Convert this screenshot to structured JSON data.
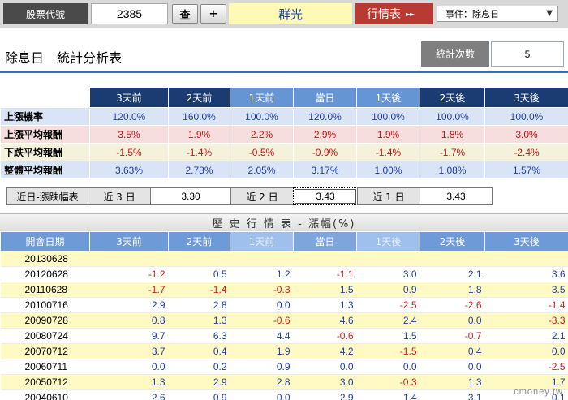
{
  "topbar": {
    "code_label": "股票代號",
    "code_value": "2385",
    "search_button": "查",
    "add_button": "+",
    "stock_name": "群光",
    "quote_link": "行情表",
    "quote_arrow": "►►",
    "event_select": "事件：除息日"
  },
  "title": {
    "main": "除息日　統計分析表",
    "stat_count_label": "統計次數",
    "stat_count_value": "5"
  },
  "stats": {
    "headers": [
      "3天前",
      "2天前",
      "1天前",
      "當日",
      "1天後",
      "2天後",
      "3天後"
    ],
    "rows": [
      {
        "label": "上漲機率",
        "values": [
          "120.0%",
          "160.0%",
          "100.0%",
          "120.0%",
          "100.0%",
          "100.0%",
          "100.0%"
        ]
      },
      {
        "label": "上漲平均報酬",
        "values": [
          "3.5%",
          "1.9%",
          "2.2%",
          "2.9%",
          "1.9%",
          "1.8%",
          "3.0%"
        ]
      },
      {
        "label": "下跌平均報酬",
        "values": [
          "-1.5%",
          "-1.4%",
          "-0.5%",
          "-0.9%",
          "-1.4%",
          "-1.7%",
          "-2.4%"
        ]
      },
      {
        "label": "整體平均報酬",
        "values": [
          "3.63%",
          "2.78%",
          "2.05%",
          "3.17%",
          "1.00%",
          "1.08%",
          "1.57%"
        ]
      }
    ]
  },
  "near": {
    "label": "近日-漲跌幅表",
    "d3_label": "近 3 日",
    "d3_value": "3.30",
    "d2_label": "近 2 日",
    "d2_value": "3.43",
    "d1_label": "近 1 日",
    "d1_value": "3.43"
  },
  "history": {
    "title": "歷 史 行 情 表 - 漲幅(%)",
    "date_header": "開會日期",
    "headers": [
      "3天前",
      "2天前",
      "1天前",
      "當日",
      "1天後",
      "2天後",
      "3天後"
    ],
    "rows": [
      {
        "date": "20130628",
        "values": [
          "",
          "",
          "",
          "",
          "",
          "",
          ""
        ]
      },
      {
        "date": "20120628",
        "values": [
          "-1.2",
          "0.5",
          "1.2",
          "-1.1",
          "3.0",
          "2.1",
          "3.6"
        ]
      },
      {
        "date": "20110628",
        "values": [
          "-1.7",
          "-1.4",
          "-0.3",
          "1.5",
          "0.9",
          "1.8",
          "3.5"
        ]
      },
      {
        "date": "20100716",
        "values": [
          "2.9",
          "2.8",
          "0.0",
          "1.3",
          "-2.5",
          "-2.6",
          "-1.4"
        ]
      },
      {
        "date": "20090728",
        "values": [
          "0.8",
          "1.3",
          "-0.6",
          "4.6",
          "2.4",
          "0.0",
          "-3.3"
        ]
      },
      {
        "date": "20080724",
        "values": [
          "9.7",
          "6.3",
          "4.4",
          "-0.6",
          "1.5",
          "-0.7",
          "2.1"
        ]
      },
      {
        "date": "20070712",
        "values": [
          "3.7",
          "0.4",
          "1.9",
          "4.2",
          "-1.5",
          "0.4",
          "0.0"
        ]
      },
      {
        "date": "20060711",
        "values": [
          "0.0",
          "0.2",
          "0.9",
          "0.0",
          "0.0",
          "0.0",
          "-2.5"
        ]
      },
      {
        "date": "20050712",
        "values": [
          "1.3",
          "2.9",
          "2.8",
          "3.0",
          "-0.3",
          "1.3",
          "1.7"
        ]
      },
      {
        "date": "20040610",
        "values": [
          "2.6",
          "0.9",
          "0.0",
          "2.9",
          "1.4",
          "3.1",
          "0.1"
        ]
      }
    ]
  },
  "watermark": "cmoney.tw",
  "colors": {
    "header_dark": "#1a3c73",
    "header_light": "#6695d6",
    "negative": "#d21c1c",
    "positive": "#1f3fa8",
    "quote_red": "#b93a32"
  }
}
